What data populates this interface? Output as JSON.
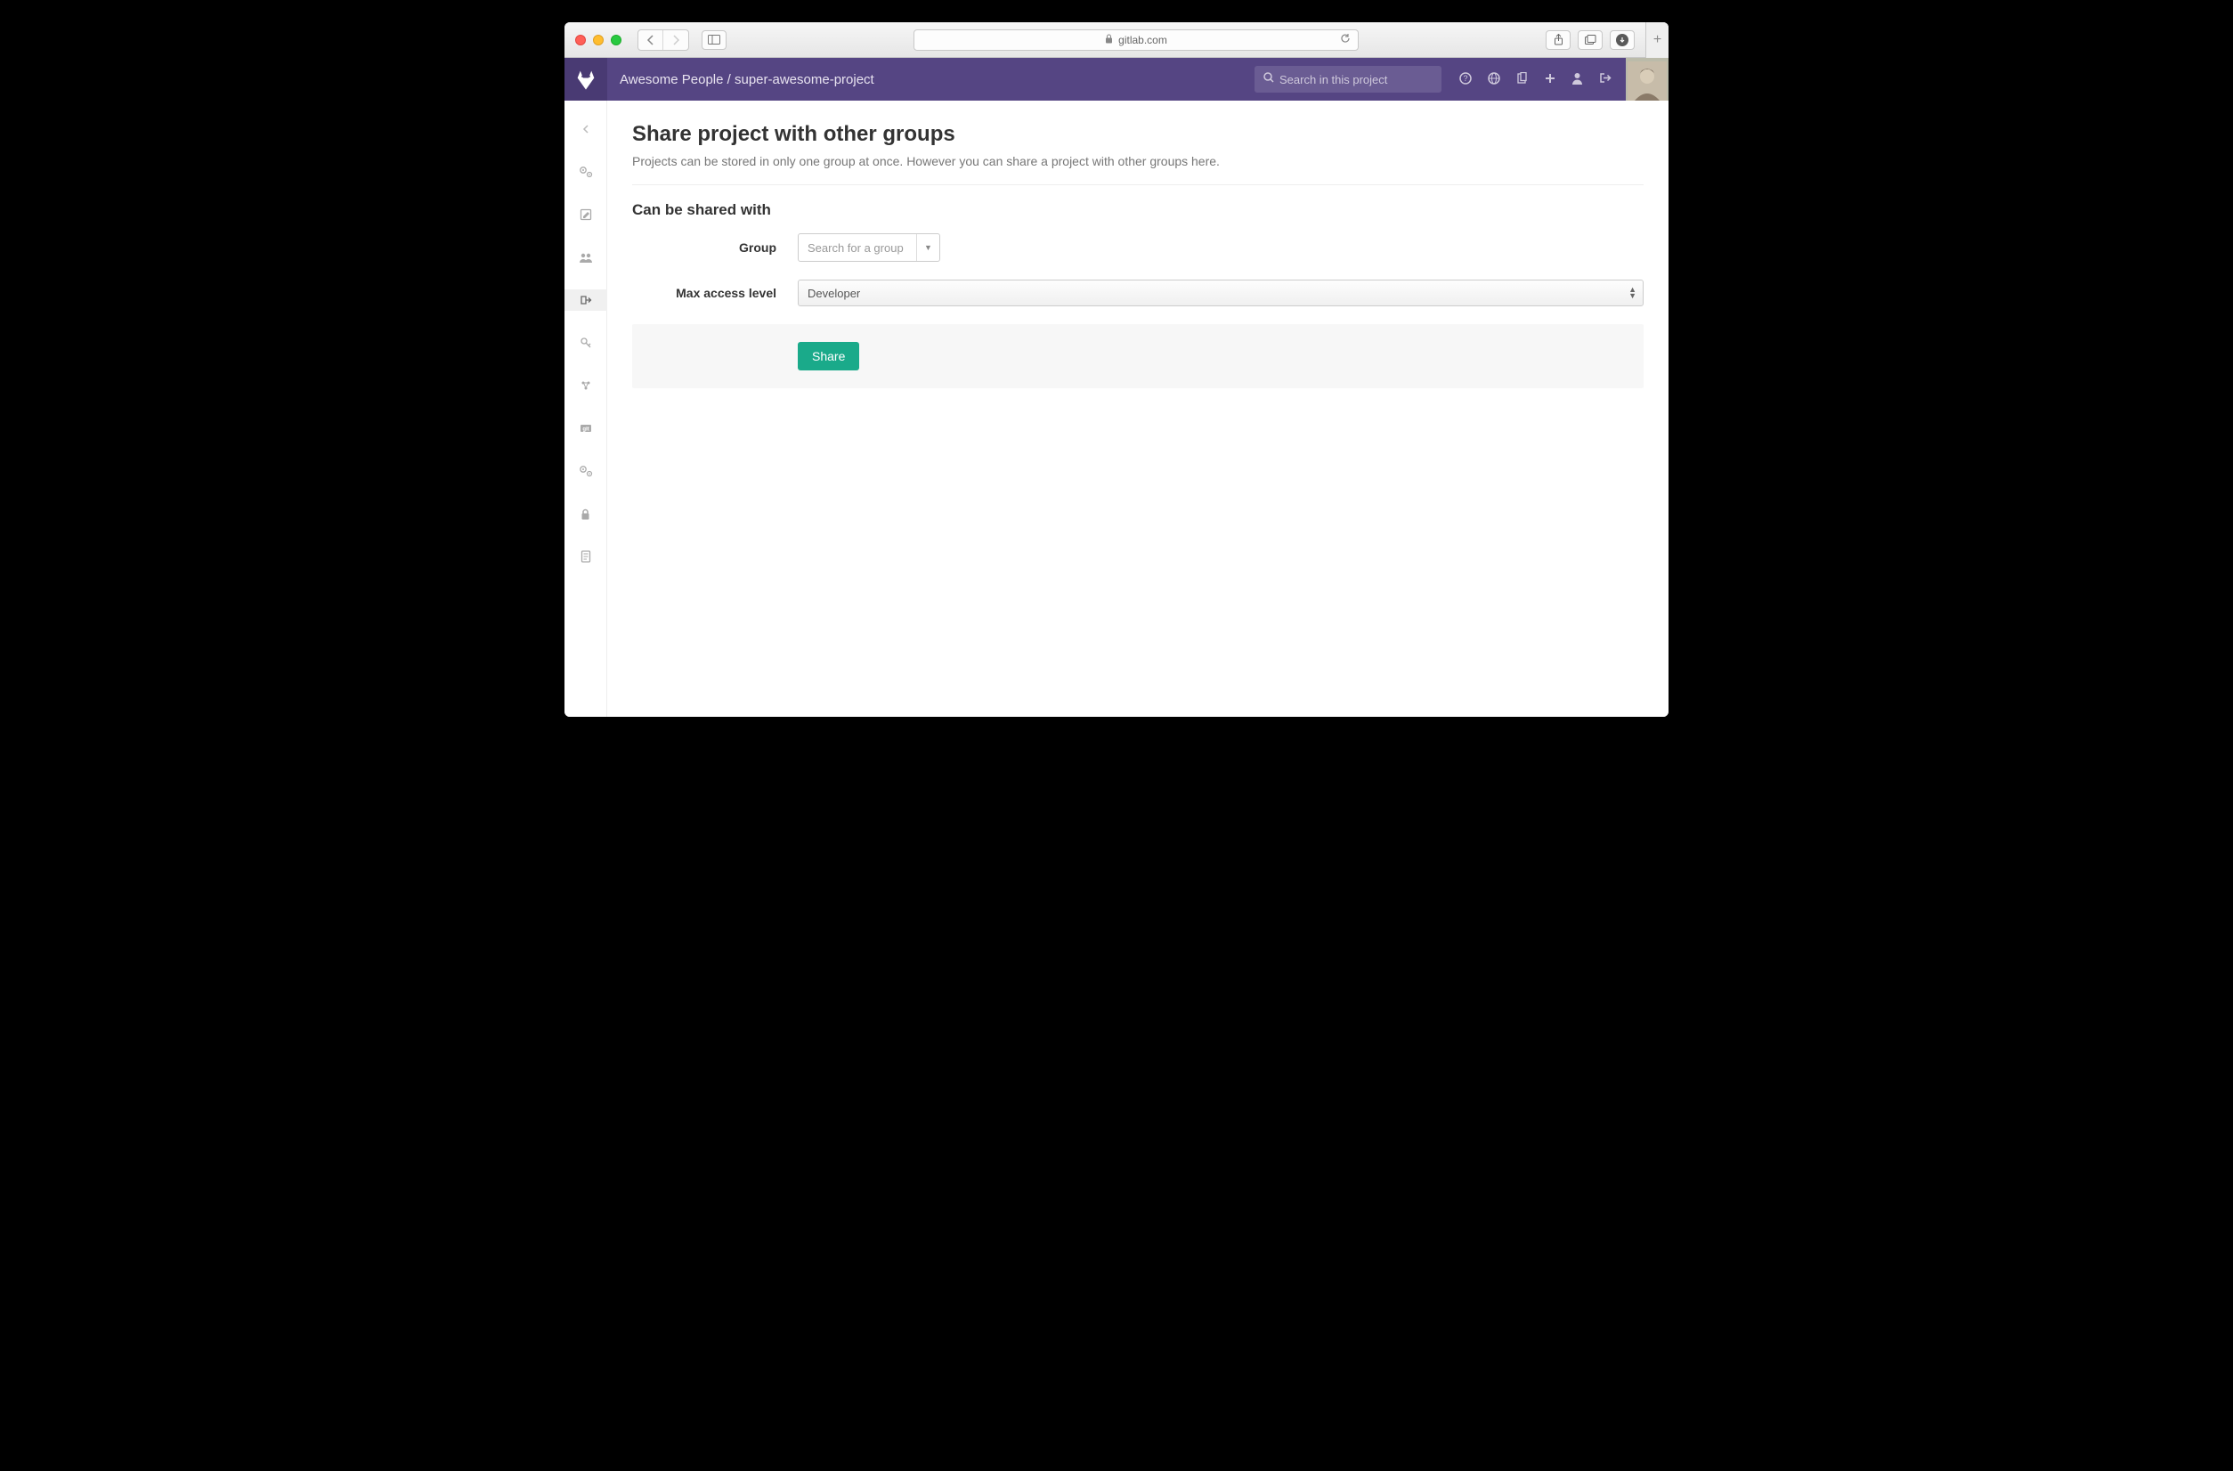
{
  "browser": {
    "url_host": "gitlab.com"
  },
  "header": {
    "breadcrumb_group": "Awesome People",
    "breadcrumb_sep": " / ",
    "breadcrumb_project": "super-awesome-project",
    "search_placeholder": "Search in this project"
  },
  "page": {
    "title": "Share project with other groups",
    "description": "Projects can be stored in only one group at once. However you can share a project with other groups here.",
    "section_title": "Can be shared with",
    "group_label": "Group",
    "group_placeholder": "Search for a group",
    "access_label": "Max access level",
    "access_selected": "Developer",
    "share_button": "Share"
  },
  "sidebar_icons": [
    "project-settings-icon",
    "edit-icon",
    "group-members-icon",
    "share-icon",
    "deploy-keys-icon",
    "webhooks-icon",
    "git-hooks-icon",
    "services-icon",
    "protected-branches-icon",
    "audit-log-icon"
  ],
  "topbar_icons": [
    "help-icon",
    "globe-icon",
    "clipboard-icon",
    "plus-icon",
    "user-icon",
    "sign-out-icon"
  ]
}
